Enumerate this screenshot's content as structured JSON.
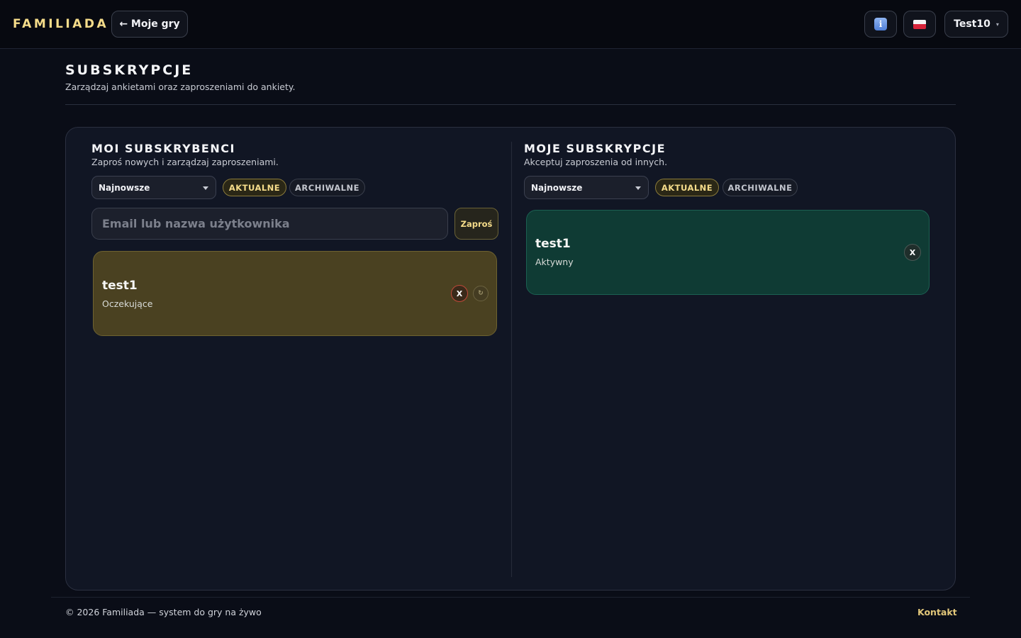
{
  "header": {
    "brand": "FAMILIADA",
    "back_label": "← Moje gry",
    "user_label": "Test10",
    "user_caret": "▾",
    "info_icon_glyph": "i"
  },
  "page": {
    "title": "SUBSKRYPCJE",
    "subtitle": "Zarządzaj ankietami oraz zaproszeniami do ankiety."
  },
  "left": {
    "title": "MOI SUBSKRYBENCI",
    "subtitle": "Zaproś nowych i zarządzaj zaproszeniami.",
    "sort_value": "Najnowsze",
    "tab_current": "AKTUALNE",
    "tab_archive": "ARCHIWALNE",
    "input_placeholder": "Email lub nazwa użytkownika",
    "invite_label": "Zaproś",
    "entries": [
      {
        "name": "test1",
        "status": "Oczekujące",
        "remove_label": "X",
        "resend_glyph": "↻"
      }
    ]
  },
  "right": {
    "title": "MOJE SUBSKRYPCJE",
    "subtitle": "Akceptuj zaproszenia od innych.",
    "sort_value": "Najnowsze",
    "tab_current": "AKTUALNE",
    "tab_archive": "ARCHIWALNE",
    "entries": [
      {
        "name": "test1",
        "status": "Aktywny",
        "remove_label": "X"
      }
    ]
  },
  "footer": {
    "copyright": "© 2026 Familiada — system do gry na żywo",
    "contact": "Kontakt"
  },
  "colors": {
    "background": "#0a0d17",
    "accent_gold": "#f5dc8a",
    "pending_bg": "#4a4121",
    "active_bg": "#0f3b34"
  },
  "icons": {
    "info": "info-icon",
    "language": "polish-flag-icon",
    "remove": "close-icon",
    "resend": "refresh-icon",
    "dropdown": "chevron-down-icon"
  }
}
